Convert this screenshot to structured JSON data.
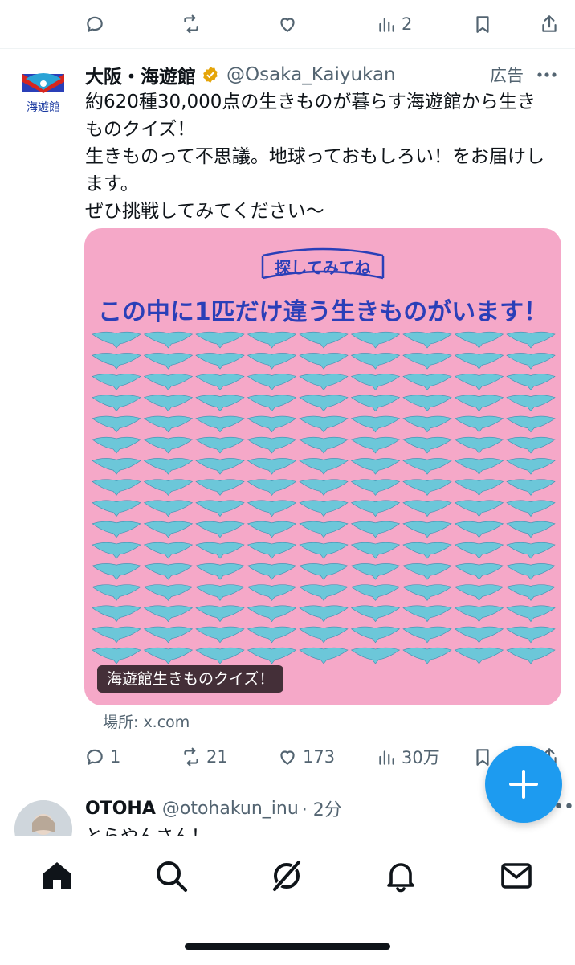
{
  "top_actions": {
    "reply_count": "",
    "retweet_count": "",
    "like_count": "",
    "view_count": "2"
  },
  "tweet": {
    "display_name": "大阪・海遊館",
    "handle": "@Osaka_Kaiyukan",
    "ad_label": "広告",
    "logo_text": "海遊館",
    "text_lines": [
      "約620種30,000点の生きものが暮らす海遊館から生き",
      "ものクイズ！",
      "生きものって不思議。地球っておもしろい！をお届けし",
      "ます。",
      "ぜひ挑戦してみてください〜"
    ],
    "media": {
      "badge": "探してみてね",
      "headline": "この中に1匹だけ違う生きものがいます！",
      "caption": "海遊館生きものクイズ！",
      "grid_rows": 16,
      "grid_cols": 9,
      "colors": {
        "background": "#f5a8c8",
        "ray": "#6cc7d9",
        "headline": "#2a3fb8"
      }
    },
    "location": "場所: x.com",
    "actions": {
      "reply_count": "1",
      "retweet_count": "21",
      "like_count": "173",
      "view_count": "30万"
    }
  },
  "reply": {
    "display_name": "OTOHA",
    "handle": "@otohakun_inu",
    "time": "· 2分",
    "text": "とらやんさん！"
  },
  "colors": {
    "accent": "#1d9bf0",
    "secondary_text": "#536471",
    "verified_badge": "#e5a50a"
  }
}
